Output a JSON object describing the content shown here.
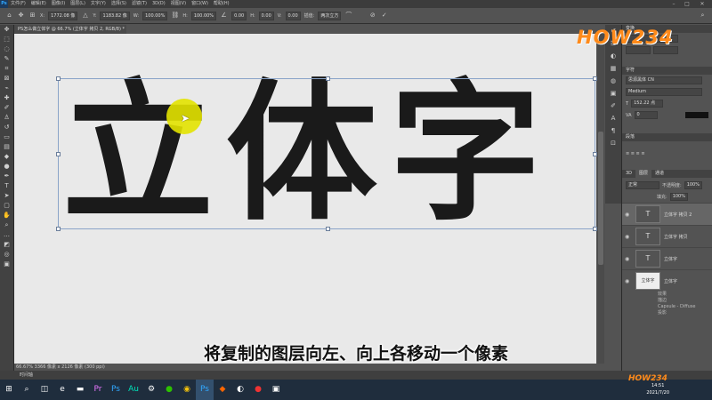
{
  "menu": {
    "logo": "Ps",
    "items": [
      "文件(F)",
      "编辑(E)",
      "图像(I)",
      "图层(L)",
      "文字(Y)",
      "选择(S)",
      "滤镜(T)",
      "3D(D)",
      "视图(V)",
      "窗口(W)",
      "帮助(H)"
    ]
  },
  "options": {
    "x_label": "X:",
    "x_value": "1772.08 像",
    "y_label": "Y:",
    "y_value": "1183.82 像",
    "w_label": "W:",
    "w_value": "100.00%",
    "h_label": "H:",
    "h_value": "100.00%",
    "angle_value": "0.00",
    "h_skew_value": "0.00",
    "v_skew_value": "0.00",
    "interp_label": "插值:",
    "interp_value": "两次立方"
  },
  "document": {
    "tab_title": "PS怎么做立体字 @ 66.7% (立体字 拷贝 2, RGB/8) *",
    "canvas_text": "立体字",
    "status": "66.67%   3366 像素 x 2126 像素 (300 ppi)",
    "timeline": "时间轴"
  },
  "subtitle": "将复制的图层向左、向上各移动一个像素",
  "watermark": "HOW234",
  "panels": {
    "properties_title": "变换",
    "character_title": "字符",
    "font_family": "思源黑体 CN",
    "font_style": "Medium",
    "font_size": "152.22 点",
    "tracking": "0",
    "paragraph_title": "段落",
    "layers_tabs": [
      "3D",
      "图层",
      "通道"
    ],
    "blend_mode": "正常",
    "opacity_label": "不透明度:",
    "opacity_value": "100%",
    "fill_label": "填充:",
    "fill_value": "100%",
    "layers": [
      {
        "name": "立体字 拷贝 2",
        "type": "T",
        "selected": true
      },
      {
        "name": "立体字 拷贝",
        "type": "T",
        "selected": false
      },
      {
        "name": "立体字",
        "type": "T",
        "selected": false
      },
      {
        "name": "立体字",
        "type": "img",
        "selected": false
      }
    ],
    "effects": [
      "效果",
      "描边",
      "Capsule - Diffuse",
      "投影"
    ]
  },
  "taskbar": {
    "time": "14:51",
    "date": "2021/7/20"
  },
  "colors": {
    "accent": "#31a8ff",
    "watermark": "#ff8a1a",
    "highlight": "#e3e300"
  }
}
